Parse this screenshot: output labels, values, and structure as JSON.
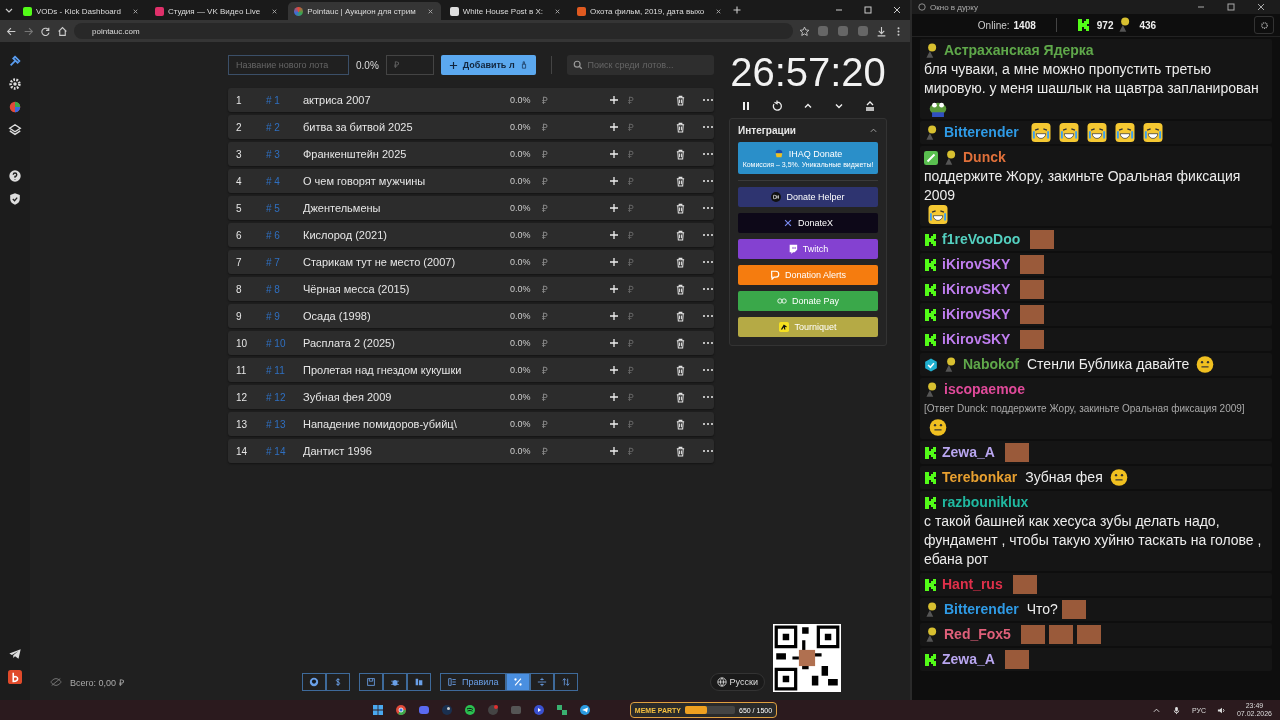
{
  "browser": {
    "tabs": [
      {
        "kind": "kick",
        "title": "VODs - Kick Dashboard",
        "selected": false
      },
      {
        "kind": "vk",
        "title": "Студия — VK Видео Live",
        "selected": false
      },
      {
        "kind": "pointauc",
        "title": "Pointauc | Аукцион для стрим",
        "selected": true
      },
      {
        "kind": "x",
        "title": "White House Post в X:",
        "selected": false
      },
      {
        "kind": "film",
        "title": "Охота фильм, 2019, дата выхо",
        "selected": false
      }
    ],
    "address": "pointauc.com"
  },
  "new_lot": {
    "placeholder": "Название нового лота",
    "percent": "0.0%",
    "amount_placeholder": "₽",
    "add_button": "Добавить л"
  },
  "search": {
    "placeholder": "Поиск среди лотов..."
  },
  "lots": [
    {
      "index": "1",
      "id": "# 1",
      "name": "актриса 2007",
      "percent": "0.0%",
      "amount": "₽",
      "add_placeholder": "₽"
    },
    {
      "index": "2",
      "id": "# 2",
      "name": "битва за битвой 2025",
      "percent": "0.0%",
      "amount": "₽",
      "add_placeholder": "₽"
    },
    {
      "index": "3",
      "id": "# 3",
      "name": "Франкенштейн 2025",
      "percent": "0.0%",
      "amount": "₽",
      "add_placeholder": "₽"
    },
    {
      "index": "4",
      "id": "# 4",
      "name": "О чем говорят мужчины",
      "percent": "0.0%",
      "amount": "₽",
      "add_placeholder": "₽"
    },
    {
      "index": "5",
      "id": "# 5",
      "name": "Джентельмены",
      "percent": "0.0%",
      "amount": "₽",
      "add_placeholder": "₽"
    },
    {
      "index": "6",
      "id": "# 6",
      "name": "Кислород (2021)",
      "percent": "0.0%",
      "amount": "₽",
      "add_placeholder": "₽"
    },
    {
      "index": "7",
      "id": "# 7",
      "name": "Старикам тут не место (2007)",
      "percent": "0.0%",
      "amount": "₽",
      "add_placeholder": "₽"
    },
    {
      "index": "8",
      "id": "# 8",
      "name": "Чёрная месса (2015)",
      "percent": "0.0%",
      "amount": "₽",
      "add_placeholder": "₽"
    },
    {
      "index": "9",
      "id": "# 9",
      "name": "Осада (1998)",
      "percent": "0.0%",
      "amount": "₽",
      "add_placeholder": "₽"
    },
    {
      "index": "10",
      "id": "# 10",
      "name": "Расплата 2 (2025)",
      "percent": "0.0%",
      "amount": "₽",
      "add_placeholder": "₽"
    },
    {
      "index": "11",
      "id": "# 11",
      "name": "Пролетая над гнездом кукушки",
      "percent": "0.0%",
      "amount": "₽",
      "add_placeholder": "₽"
    },
    {
      "index": "12",
      "id": "# 12",
      "name": "Зубная фея 2009",
      "percent": "0.0%",
      "amount": "₽",
      "add_placeholder": "₽"
    },
    {
      "index": "13",
      "id": "# 13",
      "name": "Нападение помидоров-убийц\\",
      "percent": "0.0%",
      "amount": "₽",
      "add_placeholder": "₽"
    },
    {
      "index": "14",
      "id": "# 14",
      "name": "Дантист 1996",
      "percent": "0.0%",
      "amount": "₽",
      "add_placeholder": "₽"
    }
  ],
  "timer": {
    "time": "26:57:20"
  },
  "integrations": {
    "title": "Интеграции",
    "expanded": true,
    "buttons": [
      {
        "kind": "ihaq",
        "label": "IHAQ Donate",
        "subtitle": "Комиссия – 3,5%. Уникальные виджеты!",
        "color": "#2a8fc9"
      },
      {
        "kind": "helper",
        "label": "Donate Helper",
        "color": "#2e3470"
      },
      {
        "kind": "donatex",
        "label": "DonateX",
        "color": "#0d0818"
      },
      {
        "kind": "twitch",
        "label": "Twitch",
        "color": "#8441d1"
      },
      {
        "kind": "alerts",
        "label": "Donation Alerts",
        "color": "#f57c0f"
      },
      {
        "kind": "pay",
        "label": "Donate Pay",
        "color": "#3aa84a"
      },
      {
        "kind": "tourniquet",
        "label": "Tourniquet",
        "color": "#b5aa45"
      }
    ]
  },
  "footer": {
    "total": "Всего: 0,00 ₽",
    "rules_button": "Правила",
    "modes": [
      {
        "kind": "rules",
        "selected": false
      },
      {
        "kind": "percent",
        "selected": true
      },
      {
        "kind": "split",
        "selected": false
      },
      {
        "kind": "sort",
        "selected": false
      }
    ],
    "language": "Русски"
  },
  "chat": {
    "window_title": "Окно в дурку",
    "online_label": "Online:",
    "online": "1408",
    "kick_count": "972",
    "other_count": "436",
    "messages": [
      {
        "badges": [
          {
            "kind": "bot"
          }
        ],
        "user": "Астраханская Ядерка",
        "color": "#5fa84a",
        "text": "бля чуваки, а мне можно пропустить третью мировую. у меня шашлык на щавтра запланирован",
        "emotes": [
          {
            "kind": "frog"
          }
        ]
      },
      {
        "badges": [
          {
            "kind": "bot"
          }
        ],
        "user": "Bitterender",
        "color": "#2f9be6",
        "emotes": [
          {
            "kind": "laugh"
          },
          {
            "kind": "laugh"
          },
          {
            "kind": "laugh"
          },
          {
            "kind": "laugh"
          },
          {
            "kind": "laugh"
          }
        ]
      },
      {
        "badges": [
          {
            "kind": "pencil"
          },
          {
            "kind": "bot"
          }
        ],
        "user": "Dunck",
        "color": "#e0703a",
        "text": "поддержите Жору, закиньте Оральная фиксация 2009",
        "emotes": [
          {
            "kind": "laugh"
          }
        ]
      },
      {
        "badges": [
          {
            "kind": "kick"
          }
        ],
        "user": "f1reVooDoo",
        "color": "#54d0c0",
        "emotes": [
          {
            "kind": "face"
          }
        ]
      },
      {
        "badges": [
          {
            "kind": "kick"
          }
        ],
        "user": "iKirovSKY",
        "color": "#c07ef0",
        "emotes": [
          {
            "kind": "face"
          }
        ]
      },
      {
        "badges": [
          {
            "kind": "kick"
          }
        ],
        "user": "iKirovSKY",
        "color": "#c07ef0",
        "emotes": [
          {
            "kind": "face"
          }
        ]
      },
      {
        "badges": [
          {
            "kind": "kick"
          }
        ],
        "user": "iKirovSKY",
        "color": "#c07ef0",
        "emotes": [
          {
            "kind": "face"
          }
        ]
      },
      {
        "badges": [
          {
            "kind": "kick"
          }
        ],
        "user": "iKirovSKY",
        "color": "#c07ef0",
        "emotes": [
          {
            "kind": "face"
          }
        ]
      },
      {
        "badges": [
          {
            "kind": "verified"
          },
          {
            "kind": "bot"
          }
        ],
        "user": "Nabokof",
        "color": "#5fa84a",
        "text": "Стенли Бублика давайте",
        "emotes": [
          {
            "kind": "emoji"
          }
        ]
      },
      {
        "badges": [
          {
            "kind": "bot"
          }
        ],
        "user": "iscopaemoe",
        "color": "#e04a9a",
        "reply": "[Ответ Dunck: поддержите Жору, закиньте Оральная фиксация 2009]",
        "emotes": [
          {
            "kind": "emoji"
          }
        ]
      },
      {
        "badges": [
          {
            "kind": "kick"
          }
        ],
        "user": "Zewa_A",
        "color": "#b9a6f0",
        "emotes": [
          {
            "kind": "face"
          }
        ]
      },
      {
        "badges": [
          {
            "kind": "kick"
          }
        ],
        "user": "Terebonkar",
        "color": "#e8a030",
        "text": "Зубная фея",
        "emotes": [
          {
            "kind": "emoji"
          }
        ]
      },
      {
        "badges": [
          {
            "kind": "kick"
          }
        ],
        "user": "razbouniklux",
        "color": "#20b8a0",
        "text": "с такой башней как хесуса зубы делать надо, фундамент , чтобы такую хуйню таскать на голове , ебана рот"
      },
      {
        "badges": [
          {
            "kind": "kick"
          }
        ],
        "user": "Hant_rus",
        "color": "#e0304a",
        "emotes": [
          {
            "kind": "face"
          }
        ]
      },
      {
        "badges": [
          {
            "kind": "bot"
          }
        ],
        "user": "Bitterender",
        "color": "#2f9be6",
        "text": "Что?",
        "emotes": [
          {
            "kind": "face"
          }
        ]
      },
      {
        "badges": [
          {
            "kind": "bot"
          }
        ],
        "user": "Red_Fox5",
        "color": "#e0607a",
        "emotes": [
          {
            "kind": "face"
          },
          {
            "kind": "face"
          },
          {
            "kind": "face"
          }
        ]
      },
      {
        "badges": [
          {
            "kind": "kick"
          }
        ],
        "user": "Zewa_A",
        "color": "#b9a6f0",
        "emotes": [
          {
            "kind": "face"
          }
        ]
      }
    ]
  },
  "taskbar": {
    "widget_title": "MEME PARTY",
    "widget_progress": "650 / 1500",
    "level": 0.43,
    "language": "РУС",
    "time": "23:49",
    "date": "07.02.2026"
  }
}
